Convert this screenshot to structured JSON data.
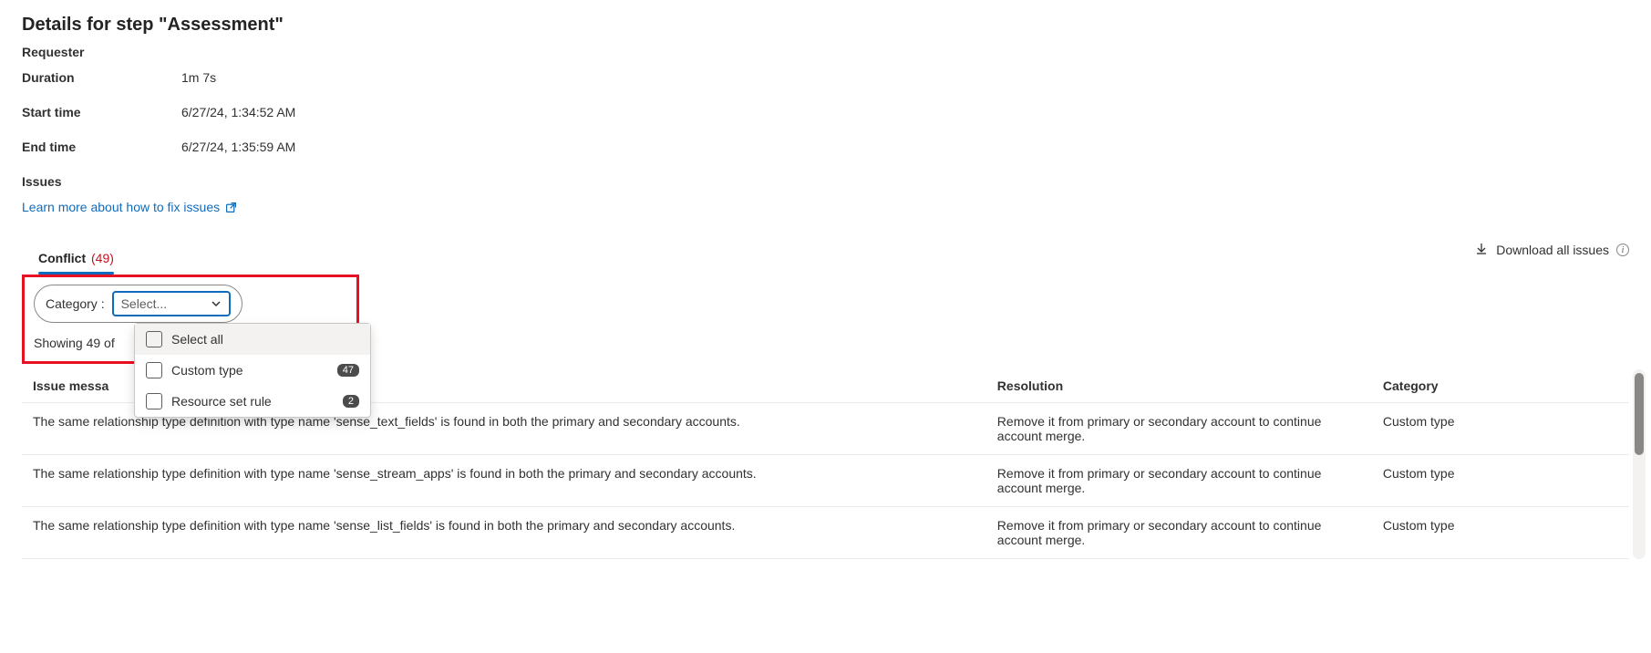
{
  "title": "Details for step \"Assessment\"",
  "requester_label": "Requester",
  "details": {
    "duration": {
      "label": "Duration",
      "value": "1m 7s"
    },
    "start_time": {
      "label": "Start time",
      "value": "6/27/24, 1:34:52 AM"
    },
    "end_time": {
      "label": "End time",
      "value": "6/27/24, 1:35:59 AM"
    }
  },
  "issues_heading": "Issues",
  "learn_more_link": "Learn more about how to fix issues",
  "tab": {
    "label": "Conflict",
    "count_text": "(49)"
  },
  "download_label": "Download all issues",
  "filter": {
    "label": "Category :",
    "placeholder": "Select...",
    "options": [
      {
        "label": "Select all",
        "badge": ""
      },
      {
        "label": "Custom type",
        "badge": "47"
      },
      {
        "label": "Resource set rule",
        "badge": "2"
      }
    ]
  },
  "showing_text": "Showing 49 of",
  "columns": {
    "msg": "Issue messa",
    "res": "Resolution",
    "cat": "Category"
  },
  "rows": [
    {
      "msg": "The same relationship type definition with type name 'sense_text_fields' is found in both the primary and secondary accounts.",
      "res": "Remove it from primary or secondary account to continue account merge.",
      "cat": "Custom type"
    },
    {
      "msg": "The same relationship type definition with type name 'sense_stream_apps' is found in both the primary and secondary accounts.",
      "res": "Remove it from primary or secondary account to continue account merge.",
      "cat": "Custom type"
    },
    {
      "msg": "The same relationship type definition with type name 'sense_list_fields' is found in both the primary and secondary accounts.",
      "res": "Remove it from primary or secondary account to continue account merge.",
      "cat": "Custom type"
    }
  ]
}
